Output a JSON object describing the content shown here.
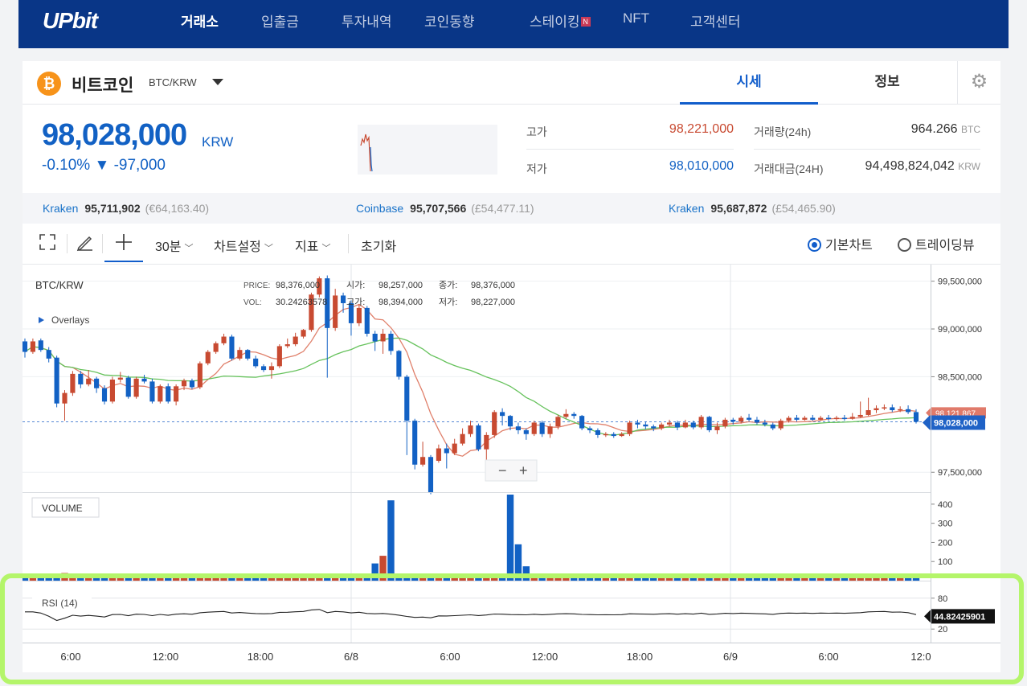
{
  "nav": {
    "logo": "UPbit",
    "items": [
      "거래소",
      "입출금",
      "투자내역",
      "코인동향",
      "스테이킹",
      "NFT",
      "고객센터"
    ],
    "staking_badge": "N",
    "colors": {
      "background": "#093687",
      "active": "#ffffff",
      "inactive": "#c3cde3"
    }
  },
  "coin": {
    "logo_symbol": "₿",
    "name": "비트코인",
    "pair": "BTC/KRW",
    "tabs": {
      "price": "시세",
      "info": "정보"
    },
    "settings_icon": "gear-icon"
  },
  "price": {
    "current": "98,028,000",
    "unit": "KRW",
    "change": "-0.10% ▼ -97,000",
    "high_label": "고가",
    "high": "98,221,000",
    "low_label": "저가",
    "low": "98,010,000",
    "volume_label": "거래량(24h)",
    "volume": "964.266",
    "volume_unit": "BTC",
    "amount_label": "거래대금(24H)",
    "amount": "94,498,824,042",
    "amount_unit": "KRW",
    "colors": {
      "up": "#c84a31",
      "down": "#1261c4"
    }
  },
  "exchanges": [
    {
      "name": "Kraken",
      "price": "95,711,902",
      "fx": "(€64,163.40)"
    },
    {
      "name": "Coinbase",
      "price": "95,707,566",
      "fx": "(£54,477.11)"
    },
    {
      "name": "Kraken",
      "price": "95,687,872",
      "fx": "(£54,465.90)"
    }
  ],
  "toolbar": {
    "fullscreen_icon": "fullscreen-icon",
    "draw_icon": "pencil-icon",
    "crosshair_icon": "crosshair-icon",
    "interval": "30분",
    "chart_settings": "차트설정",
    "indicators": "지표",
    "reset": "초기화",
    "basic_chart": "기본차트",
    "tradingview": "트레이딩뷰"
  },
  "chart_data": {
    "type": "candlestick",
    "symbol": "BTC/KRW",
    "overlays_label": "Overlays",
    "legend": {
      "price_label": "PRICE:",
      "price": "98,376,000",
      "vol_label": "VOL:",
      "vol": "30.24263578",
      "open_label": "시가:",
      "open": "98,257,000",
      "close_label": "종가:",
      "close": "98,376,000",
      "high_label": "고가:",
      "high": "98,394,000",
      "low_label": "저가:",
      "low": "98,227,000"
    },
    "y_ticks": [
      "99,500,000",
      "99,000,000",
      "98,500,000",
      "97,500,000"
    ],
    "y_range": [
      97300000,
      99640000
    ],
    "x_ticks": [
      "6:00",
      "12:00",
      "18:00",
      "6/8",
      "6:00",
      "12:00",
      "18:00",
      "6/9",
      "6:00",
      "12:0"
    ],
    "price_tags": {
      "ma_value": "98,121,867",
      "current": "98,028,000"
    },
    "zoom": {
      "out": "−",
      "in": "+"
    },
    "candles": [
      [
        98870000,
        98760000,
        98900000,
        98700000
      ],
      [
        98760000,
        98870000,
        98900000,
        98740000
      ],
      [
        98880000,
        98780000,
        98900000,
        98760000
      ],
      [
        98780000,
        98690000,
        98810000,
        98650000
      ],
      [
        98700000,
        98220000,
        98720000,
        98180000
      ],
      [
        98220000,
        98330000,
        98360000,
        98040000
      ],
      [
        98330000,
        98530000,
        98560000,
        98300000
      ],
      [
        98530000,
        98420000,
        98560000,
        98380000
      ],
      [
        98420000,
        98480000,
        98570000,
        98400000
      ],
      [
        98480000,
        98380000,
        98500000,
        98330000
      ],
      [
        98380000,
        98240000,
        98410000,
        98210000
      ],
      [
        98240000,
        98470000,
        98500000,
        98220000
      ],
      [
        98470000,
        98490000,
        98550000,
        98440000
      ],
      [
        98490000,
        98290000,
        98510000,
        98270000
      ],
      [
        98290000,
        98480000,
        98500000,
        98270000
      ],
      [
        98480000,
        98450000,
        98520000,
        98430000
      ],
      [
        98450000,
        98240000,
        98480000,
        98220000
      ],
      [
        98240000,
        98400000,
        98420000,
        98220000
      ],
      [
        98400000,
        98240000,
        98430000,
        98220000
      ],
      [
        98240000,
        98400000,
        98420000,
        98200000
      ],
      [
        98400000,
        98460000,
        98480000,
        98360000
      ],
      [
        98460000,
        98390000,
        98480000,
        98370000
      ],
      [
        98390000,
        98640000,
        98660000,
        98370000
      ],
      [
        98640000,
        98760000,
        98780000,
        98620000
      ],
      [
        98760000,
        98850000,
        98870000,
        98740000
      ],
      [
        98850000,
        98920000,
        98950000,
        98830000
      ],
      [
        98920000,
        98690000,
        98940000,
        98670000
      ],
      [
        98690000,
        98780000,
        98810000,
        98670000
      ],
      [
        98780000,
        98690000,
        98790000,
        98670000
      ],
      [
        98690000,
        98610000,
        98720000,
        98590000
      ],
      [
        98610000,
        98570000,
        98630000,
        98550000
      ],
      [
        98570000,
        98610000,
        98650000,
        98480000
      ],
      [
        98610000,
        98820000,
        98840000,
        98590000
      ],
      [
        98820000,
        98840000,
        98900000,
        98800000
      ],
      [
        98840000,
        98920000,
        98960000,
        98820000
      ],
      [
        98920000,
        98990000,
        99000000,
        98900000
      ],
      [
        98990000,
        99360000,
        99380000,
        98970000
      ],
      [
        99360000,
        99530000,
        99550000,
        99330000
      ],
      [
        99530000,
        99010000,
        99560000,
        98490000
      ],
      [
        99010000,
        99350000,
        99420000,
        98980000
      ],
      [
        99350000,
        99270000,
        99380000,
        99170000
      ],
      [
        99270000,
        99060000,
        99300000,
        98930000
      ],
      [
        99060000,
        99220000,
        99260000,
        99030000
      ],
      [
        99220000,
        98950000,
        99240000,
        98920000
      ],
      [
        98950000,
        98870000,
        98980000,
        98770000
      ],
      [
        98870000,
        98950000,
        99000000,
        98740000
      ],
      [
        98950000,
        98770000,
        98980000,
        98730000
      ],
      [
        98770000,
        98500000,
        98780000,
        98470000
      ],
      [
        98500000,
        98040000,
        98520000,
        97680000
      ],
      [
        98040000,
        97580000,
        98060000,
        97530000
      ],
      [
        97580000,
        97660000,
        97820000,
        97560000
      ],
      [
        97660000,
        97290000,
        97680000,
        97270000
      ],
      [
        97620000,
        97750000,
        97790000,
        97600000
      ],
      [
        97750000,
        97700000,
        97800000,
        97540000
      ],
      [
        97700000,
        97800000,
        97850000,
        97680000
      ],
      [
        97800000,
        97900000,
        97960000,
        97780000
      ],
      [
        97900000,
        97990000,
        98040000,
        97870000
      ],
      [
        97990000,
        97740000,
        98010000,
        97720000
      ],
      [
        97740000,
        97890000,
        97920000,
        97630000
      ],
      [
        97890000,
        98130000,
        98150000,
        97860000
      ],
      [
        98130000,
        98090000,
        98170000,
        97990000
      ],
      [
        98090000,
        97980000,
        98100000,
        97940000
      ],
      [
        97980000,
        97940000,
        98020000,
        97900000
      ],
      [
        97940000,
        97900000,
        97960000,
        97840000
      ],
      [
        97900000,
        98020000,
        98040000,
        97880000
      ],
      [
        98020000,
        97900000,
        98040000,
        97870000
      ],
      [
        97900000,
        97980000,
        98010000,
        97860000
      ],
      [
        97980000,
        98080000,
        98100000,
        97950000
      ],
      [
        98080000,
        98110000,
        98160000,
        98060000
      ],
      [
        98110000,
        98090000,
        98130000,
        98060000
      ],
      [
        98090000,
        97960000,
        98100000,
        97940000
      ],
      [
        97960000,
        97940000,
        97980000,
        97910000
      ],
      [
        97940000,
        97890000,
        97960000,
        97860000
      ],
      [
        97890000,
        97900000,
        97920000,
        97870000
      ],
      [
        97900000,
        97880000,
        97920000,
        97860000
      ],
      [
        97880000,
        97900000,
        97920000,
        97870000
      ],
      [
        97900000,
        98020000,
        98040000,
        97880000
      ],
      [
        98020000,
        98000000,
        98050000,
        97960000
      ],
      [
        98000000,
        97980000,
        98030000,
        97950000
      ],
      [
        97980000,
        97960000,
        98000000,
        97930000
      ],
      [
        97960000,
        98000000,
        98020000,
        97940000
      ],
      [
        98000000,
        98020000,
        98050000,
        97980000
      ],
      [
        98020000,
        97970000,
        98040000,
        97940000
      ],
      [
        97970000,
        98020000,
        98050000,
        97960000
      ],
      [
        98020000,
        97970000,
        98040000,
        97950000
      ],
      [
        97970000,
        98080000,
        98100000,
        97950000
      ],
      [
        98080000,
        97940000,
        98090000,
        97920000
      ],
      [
        97940000,
        97980000,
        98020000,
        97900000
      ],
      [
        97980000,
        98050000,
        98070000,
        97960000
      ],
      [
        98050000,
        98030000,
        98070000,
        98000000
      ],
      [
        98030000,
        98070000,
        98090000,
        98010000
      ],
      [
        98070000,
        98050000,
        98110000,
        98030000
      ],
      [
        98050000,
        98020000,
        98080000,
        98000000
      ],
      [
        98020000,
        98000000,
        98050000,
        97980000
      ],
      [
        98000000,
        97960000,
        98020000,
        97940000
      ],
      [
        97960000,
        98040000,
        98060000,
        97940000
      ],
      [
        98040000,
        98070000,
        98090000,
        98020000
      ],
      [
        98070000,
        98050000,
        98100000,
        98030000
      ],
      [
        98050000,
        98070000,
        98090000,
        98040000
      ],
      [
        98070000,
        98050000,
        98100000,
        98040000
      ],
      [
        98050000,
        98070000,
        98090000,
        98040000
      ],
      [
        98070000,
        98060000,
        98100000,
        98040000
      ],
      [
        98060000,
        98070000,
        98090000,
        98040000
      ],
      [
        98070000,
        98060000,
        98100000,
        98040000
      ],
      [
        98060000,
        98080000,
        98120000,
        98050000
      ],
      [
        98080000,
        98100000,
        98240000,
        98070000
      ],
      [
        98100000,
        98150000,
        98280000,
        98090000
      ],
      [
        98150000,
        98170000,
        98200000,
        98120000
      ],
      [
        98170000,
        98180000,
        98210000,
        98150000
      ],
      [
        98180000,
        98150000,
        98210000,
        98130000
      ],
      [
        98150000,
        98160000,
        98190000,
        98130000
      ],
      [
        98160000,
        98130000,
        98200000,
        98110000
      ],
      [
        98130000,
        98028000,
        98160000,
        98010000
      ]
    ],
    "volume_label": "VOLUME",
    "volume_ticks": [
      "400",
      "300",
      "200",
      "100"
    ],
    "volume_spikes": {
      "5": 40,
      "44": 90,
      "45": 130,
      "46": 420,
      "61": 520,
      "62": 190,
      "63": 75
    },
    "rsi_label": "RSI (14)",
    "rsi_ticks": [
      "80",
      "20"
    ],
    "rsi_value": "44.82425901",
    "colors": {
      "up": "#c84a31",
      "down": "#1261c4",
      "ma_short": "#e0806b",
      "ma_long": "#66c25c",
      "rsi": "#222222",
      "last_price": "#1f62c6",
      "ma_tag": "#e07a6a"
    }
  }
}
